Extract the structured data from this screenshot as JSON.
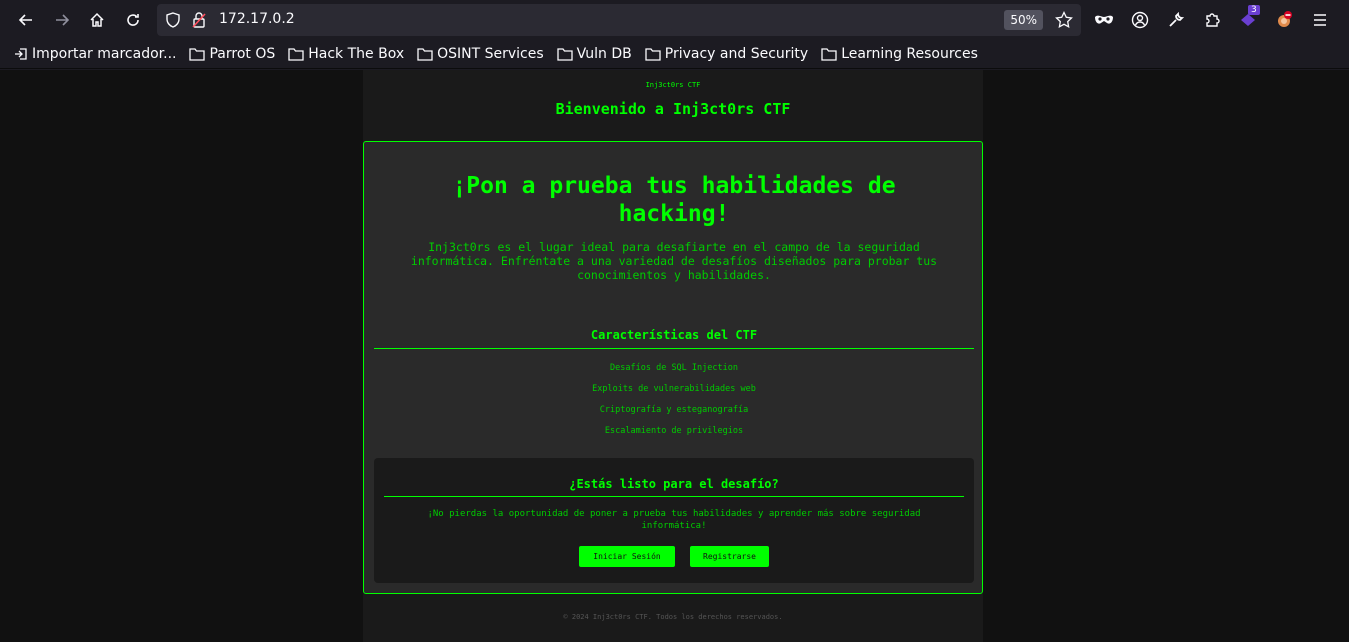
{
  "browser": {
    "url": "172.17.0.2",
    "zoom": "50%",
    "extension_badge": "3",
    "bookmarks": [
      {
        "label": "Importar marcador...",
        "icon": "import-icon"
      },
      {
        "label": "Parrot OS",
        "icon": "folder-icon"
      },
      {
        "label": "Hack The Box",
        "icon": "folder-icon"
      },
      {
        "label": "OSINT Services",
        "icon": "folder-icon"
      },
      {
        "label": "Vuln DB",
        "icon": "folder-icon"
      },
      {
        "label": "Privacy and Security",
        "icon": "folder-icon"
      },
      {
        "label": "Learning Resources",
        "icon": "folder-icon"
      }
    ]
  },
  "page": {
    "brand": "Inj3ct0rs CTF",
    "welcome": "Bienvenido a Inj3ct0rs CTF",
    "hero_title": "¡Pon a prueba tus habilidades de hacking!",
    "hero_text": "Inj3ct0rs es el lugar ideal para desafiarte en el campo de la seguridad informática. Enfréntate a una variedad de desafíos diseñados para probar tus conocimientos y habilidades.",
    "features_title": "Características del CTF",
    "features": [
      "Desafíos de SQL Injection",
      "Exploits de vulnerabilidades web",
      "Criptografía y esteganografía",
      "Escalamiento de privilegios"
    ],
    "cta_title": "¿Estás listo para el desafío?",
    "cta_text": "¡No pierdas la oportunidad de poner a prueba tus habilidades y aprender más sobre seguridad informática!",
    "login_label": "Iniciar Sesión",
    "register_label": "Registrarse",
    "footer": "© 2024 Inj3ct0rs CTF. Todos los derechos reservados."
  },
  "colors": {
    "accent": "#00ff00",
    "page_bg": "#1a1a1a",
    "card_bg": "#2a2a2a"
  }
}
